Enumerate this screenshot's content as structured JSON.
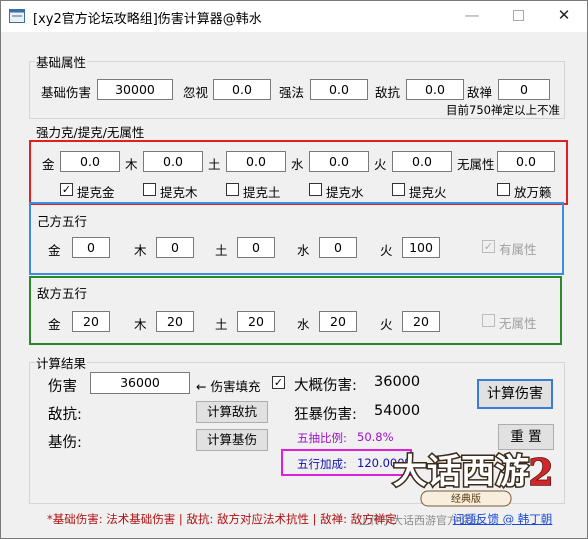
{
  "window": {
    "title": "[xy2官方论坛攻略组]伤害计算器@韩水",
    "min_glyph": "—",
    "close_glyph": "✕"
  },
  "basic": {
    "group_title": "基础属性",
    "base_damage_label": "基础伤害",
    "base_damage_value": "30000",
    "ignore_label": "忽视",
    "ignore_value": "0.0",
    "strong_spell_label": "强法",
    "strong_spell_value": "0.0",
    "enemy_resist_label": "敌抗",
    "enemy_resist_value": "0.0",
    "enemy_zen_label": "敌禅",
    "enemy_zen_value": "0",
    "note": "目前750禅定以上不准"
  },
  "restraint": {
    "group_title": "强力克/提克/无属性",
    "gold_label": "金",
    "gold_value": "0.0",
    "wood_label": "木",
    "wood_value": "0.0",
    "earth_label": "土",
    "earth_value": "0.0",
    "water_label": "水",
    "water_value": "0.0",
    "fire_label": "火",
    "fire_value": "0.0",
    "none_label": "无属性",
    "none_value": "0.0",
    "cb_gold_label": "提克金",
    "cb_gold_mark": "✓",
    "cb_wood_label": "提克木",
    "cb_earth_label": "提克土",
    "cb_water_label": "提克水",
    "cb_fire_label": "提克火",
    "cb_wanlv_label": "放万籁"
  },
  "own_elements": {
    "group_title": "己方五行",
    "gold_label": "金",
    "gold_value": "0",
    "wood_label": "木",
    "wood_value": "0",
    "earth_label": "土",
    "earth_value": "0",
    "water_label": "水",
    "water_value": "0",
    "fire_label": "火",
    "fire_value": "100",
    "has_attr_label": "有属性",
    "has_attr_mark": "✓"
  },
  "enemy_elements": {
    "group_title": "敌方五行",
    "gold_label": "金",
    "gold_value": "20",
    "wood_label": "木",
    "wood_value": "20",
    "earth_label": "土",
    "earth_value": "20",
    "water_label": "水",
    "water_value": "20",
    "fire_label": "火",
    "fire_value": "20",
    "no_attr_label": "无属性"
  },
  "results": {
    "group_title": "计算结果",
    "damage_label": "伤害",
    "damage_value": "36000",
    "fill_label": "← 伤害填充",
    "fill_mark": "✓",
    "approx_label": "大概伤害:",
    "approx_value": "36000",
    "resist_label": "敌抗:",
    "calc_resist_button": "计算敌抗",
    "crit_label": "狂暴伤害:",
    "crit_value": "54000",
    "base_label": "基伤:",
    "calc_base_button": "计算基伤",
    "five_ratio_label": "五抽比例:",
    "five_ratio_value": "50.8%",
    "element_bonus_label": "五行加成:",
    "element_bonus_value": "120.000%",
    "calc_damage_button": "计算伤害",
    "reset_button": "重 置"
  },
  "footer": {
    "legend": "*基础伤害: 法术基础伤害  |  敌抗: 敌方对应法术抗性  |  敌禅: 敌方禅定",
    "feedback_link": "问题反馈 @ 韩丁朝",
    "watermark": "上传于大话西游官方论坛"
  },
  "logo": {
    "text": "大话西游",
    "number": "2",
    "subtitle": "经典版"
  }
}
